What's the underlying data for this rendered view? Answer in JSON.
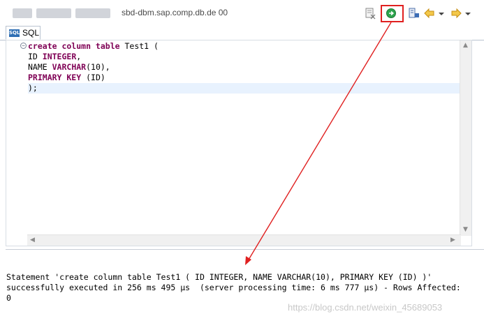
{
  "window": {
    "title": "sbd-dbm.sap.comp.db.de 00"
  },
  "toolbar": {
    "items": [
      {
        "icon": "sql-preferences-icon"
      },
      {
        "icon": "execute-icon",
        "highlighted": true,
        "highlight_color": "#e02020"
      },
      {
        "icon": "format-icon"
      },
      {
        "icon": "back-arrow-icon"
      },
      {
        "icon": "dropdown-icon"
      },
      {
        "icon": "forward-arrow-icon"
      },
      {
        "icon": "dropdown-icon"
      }
    ]
  },
  "tab": {
    "icon_text": "SQL",
    "label": "SQL"
  },
  "editor": {
    "lines": [
      [
        {
          "t": "create column table ",
          "kw": true
        },
        {
          "t": "Test1 (",
          "kw": false
        }
      ],
      [
        {
          "t": "ID ",
          "kw": false
        },
        {
          "t": "INTEGER",
          "kw": true
        },
        {
          "t": ",",
          "kw": false
        }
      ],
      [
        {
          "t": "NAME ",
          "kw": false
        },
        {
          "t": "VARCHAR",
          "kw": true
        },
        {
          "t": "(10),",
          "kw": false
        }
      ],
      [
        {
          "t": "PRIMARY KEY",
          "kw": true
        },
        {
          "t": " (ID)",
          "kw": false
        }
      ],
      [
        {
          "t": ");",
          "kw": false
        }
      ]
    ],
    "current_line": 5
  },
  "result": {
    "line1": "Statement 'create column table Test1 ( ID INTEGER, NAME VARCHAR(10), PRIMARY KEY (ID) )'",
    "line2": "successfully executed in 256 ms 495 µs  (server processing time: 6 ms 777 µs) - Rows Affected:",
    "line3": "0"
  },
  "watermark": "https://blog.csdn.net/weixin_45689053",
  "colors": {
    "keyword": "#7f0055",
    "annotation": "#e02020",
    "current_line": "#e8f2fe"
  }
}
